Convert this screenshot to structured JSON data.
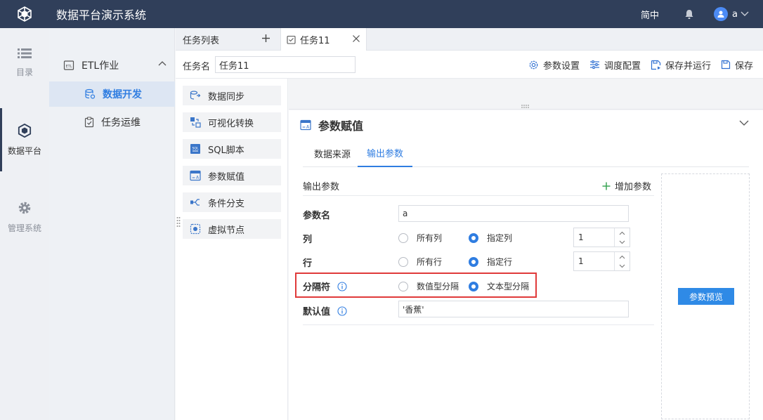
{
  "app": {
    "title": "数据平台演示系统"
  },
  "header": {
    "language": "简中",
    "user_name": "a"
  },
  "rail": [
    {
      "label": "目录",
      "icon": "list-icon"
    },
    {
      "label": "数据平台",
      "icon": "cube-icon"
    },
    {
      "label": "管理系统",
      "icon": "gear-icon"
    }
  ],
  "subnav": {
    "group": "ETL作业",
    "items": [
      {
        "label": "数据开发",
        "active": true
      },
      {
        "label": "任务运维",
        "active": false
      }
    ]
  },
  "tabs": {
    "list_label": "任务列表",
    "task_label": "任务11"
  },
  "task": {
    "name_label": "任务名",
    "name_value": "任务11",
    "actions": [
      "参数设置",
      "调度配置",
      "保存并运行",
      "保存"
    ]
  },
  "components": [
    "数据同步",
    "可视化转换",
    "SQL脚本",
    "参数赋值",
    "条件分支",
    "虚拟节点"
  ],
  "panel": {
    "title": "参数赋值",
    "tabs": [
      "数据来源",
      "输出参数"
    ],
    "section_title": "输出参数",
    "add_label": "增加参数",
    "fields": {
      "param_name": {
        "label": "参数名",
        "value": "a"
      },
      "column": {
        "label": "列",
        "options": [
          "所有列",
          "指定列"
        ],
        "selected": "指定列",
        "value": "1"
      },
      "row": {
        "label": "行",
        "options": [
          "所有行",
          "指定行"
        ],
        "selected": "指定行",
        "value": "1"
      },
      "separator": {
        "label": "分隔符",
        "options": [
          "数值型分隔",
          "文本型分隔"
        ],
        "selected": "文本型分隔"
      },
      "default": {
        "label": "默认值",
        "value": "'香蕉'"
      }
    },
    "preview_label": "参数预览"
  },
  "colors": {
    "header_bg": "#303f5a",
    "accent": "#2f7de1",
    "highlight": "#e03a3a"
  }
}
